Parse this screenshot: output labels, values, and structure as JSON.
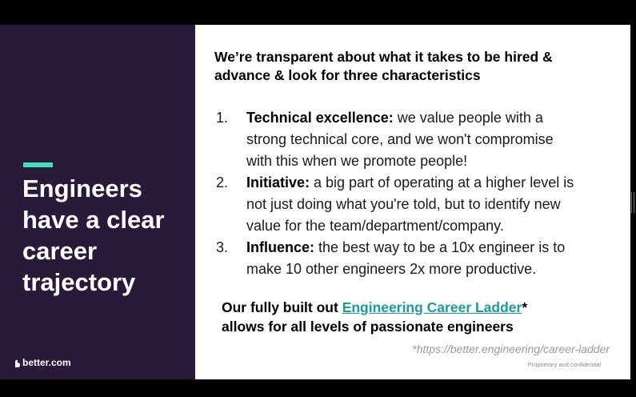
{
  "left_panel": {
    "headline_lines": [
      "Engineers",
      "have a clear",
      "career",
      "trajectory"
    ],
    "logo_text": "better.com",
    "accent_color": "#3ee0c0",
    "background_color": "#2a1a3a"
  },
  "right_panel": {
    "intro_lines": [
      "We’re transparent about what it takes to be hired &",
      "advance & look for three characteristics"
    ],
    "characteristics": [
      {
        "number": "1.",
        "title": "Technical excellence:",
        "lines": [
          " we value people with a",
          "strong technical core, and we won't compromise",
          "with this when we promote people!"
        ]
      },
      {
        "number": "2.",
        "title": "Initiative:",
        "lines": [
          " a big part of operating at a higher level is",
          "not just doing what you're told, but to identify new",
          "value for the team/department/company."
        ]
      },
      {
        "number": "3.",
        "title": "Influence:",
        "lines": [
          " the best way to be a 10x engineer is to",
          "make 10 other engineers 2x more productive."
        ]
      }
    ],
    "ladder": {
      "prefix": "Our fully built out ",
      "link_text": "Engineering Career Ladder",
      "suffix": "*",
      "second_line": "allows for all levels of passionate engineers",
      "link_color": "#1a9c9c"
    },
    "footnote": "*https://better.engineering/career-ladder",
    "confidential": "Proprietary and confidential"
  }
}
